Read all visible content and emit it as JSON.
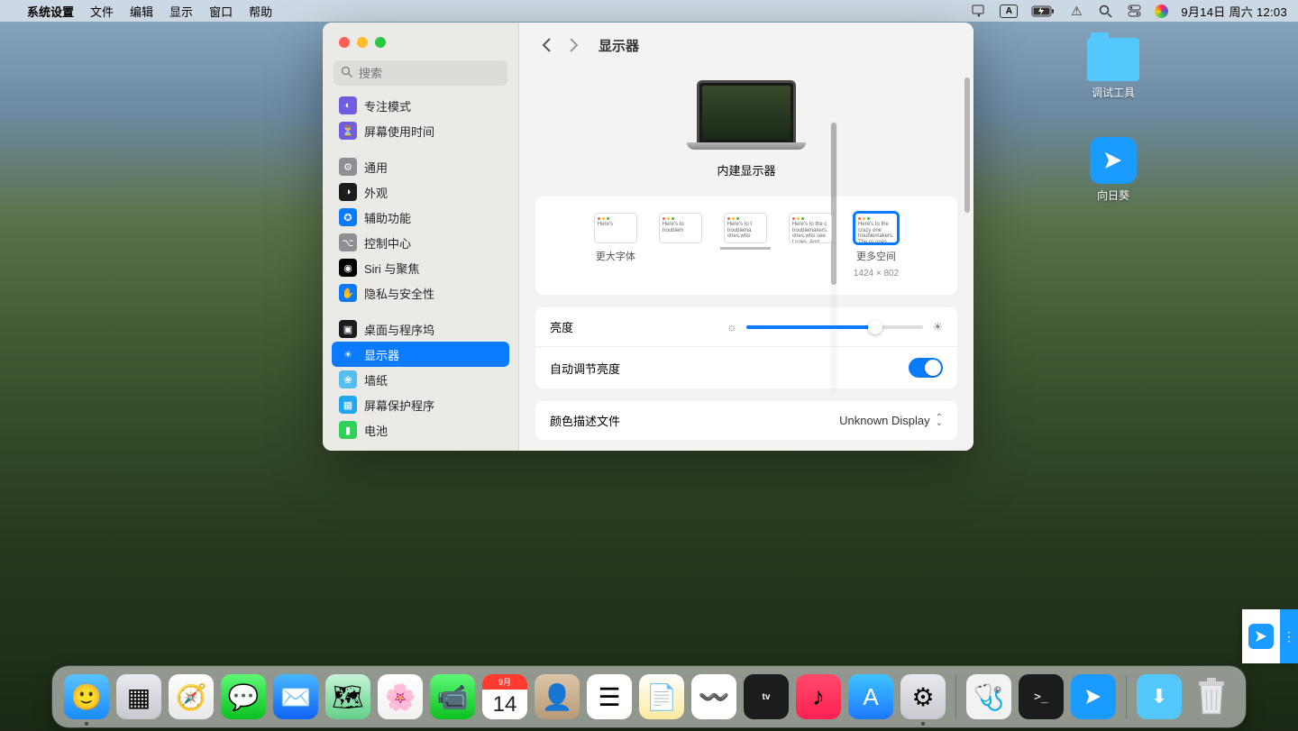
{
  "menubar": {
    "app": "系统设置",
    "items": [
      "文件",
      "编辑",
      "显示",
      "窗口",
      "帮助"
    ],
    "datetime": "9月14日 周六  12:03"
  },
  "desktop": {
    "icon1": "调试工具",
    "icon2": "向日葵"
  },
  "window": {
    "search_placeholder": "搜索",
    "title": "显示器",
    "sidebar": [
      {
        "label": "专注模式",
        "color": "#6f5ce0",
        "glyph": "◐"
      },
      {
        "label": "屏幕使用时间",
        "color": "#6f5ce0",
        "glyph": "⏳"
      },
      {
        "gap": true
      },
      {
        "label": "通用",
        "color": "#8e8e93",
        "glyph": "⚙"
      },
      {
        "label": "外观",
        "color": "#1c1c1e",
        "glyph": "◑"
      },
      {
        "label": "辅助功能",
        "color": "#0a7aff",
        "glyph": "✪"
      },
      {
        "label": "控制中心",
        "color": "#8e8e93",
        "glyph": "⌥"
      },
      {
        "label": "Siri 与聚焦",
        "color": "#000",
        "glyph": "◉"
      },
      {
        "label": "隐私与安全性",
        "color": "#0a7aff",
        "glyph": "✋"
      },
      {
        "gap": true
      },
      {
        "label": "桌面与程序坞",
        "color": "#1c1c1e",
        "glyph": "▣"
      },
      {
        "label": "显示器",
        "color": "#0a7aff",
        "glyph": "☀",
        "selected": true
      },
      {
        "label": "墙纸",
        "color": "#55bef0",
        "glyph": "❀"
      },
      {
        "label": "屏幕保护程序",
        "color": "#22a6ef",
        "glyph": "▦"
      },
      {
        "label": "电池",
        "color": "#30d158",
        "glyph": "▮"
      }
    ],
    "display_name": "内建显示器",
    "resolutions": {
      "larger": "更大字体",
      "more_space": "更多空间",
      "more_space_sub": "1424 × 802",
      "samples": [
        "Here's",
        "Here's to troublem",
        "Here's to t troublema ones who",
        "Here's to the c troublemakers. ones who see t rules. And they",
        "Here's to the crazy one troublemakers. The ro ones who see things d rules. And they have..."
      ]
    },
    "brightness_label": "亮度",
    "auto_brightness_label": "自动调节亮度",
    "color_profile_label": "颜色描述文件",
    "color_profile_value": "Unknown Display"
  },
  "dock": {
    "apps": [
      {
        "name": "finder",
        "bg": "linear-gradient(#59c3ff,#1a8bff)",
        "glyph": "🙂",
        "running": true
      },
      {
        "name": "launchpad",
        "bg": "linear-gradient(#e9e9ef,#c8c8d0)",
        "glyph": "▦"
      },
      {
        "name": "safari",
        "bg": "linear-gradient(#fefefe,#e8e8ea)",
        "glyph": "🧭"
      },
      {
        "name": "messages",
        "bg": "linear-gradient(#5ef777,#0bc11f)",
        "glyph": "💬"
      },
      {
        "name": "mail",
        "bg": "linear-gradient(#47b7ff,#1062f6)",
        "glyph": "✉️"
      },
      {
        "name": "maps",
        "bg": "linear-gradient(#c6f3d6,#64d08a)",
        "glyph": "🗺"
      },
      {
        "name": "photos",
        "bg": "linear-gradient(#fff,#f1f1f1)",
        "glyph": "🌸"
      },
      {
        "name": "facetime",
        "bg": "linear-gradient(#5ef777,#0bc11f)",
        "glyph": "📹"
      },
      {
        "name": "calendar",
        "bg": "#fff",
        "glyph": "",
        "cal": true
      },
      {
        "name": "contacts",
        "bg": "linear-gradient(#dcc6a8,#b89b78)",
        "glyph": "👤"
      },
      {
        "name": "reminders",
        "bg": "#fff",
        "glyph": "☰"
      },
      {
        "name": "notes",
        "bg": "linear-gradient(#fff,#ffe99e)",
        "glyph": "📄"
      },
      {
        "name": "freeform",
        "bg": "#fff",
        "glyph": "〰️"
      },
      {
        "name": "tv",
        "bg": "#1c1c1e",
        "glyph": "tv"
      },
      {
        "name": "music",
        "bg": "linear-gradient(#ff4a6b,#ff2151)",
        "glyph": "♪"
      },
      {
        "name": "appstore",
        "bg": "linear-gradient(#3fc4ff,#1c78ff)",
        "glyph": "A"
      },
      {
        "name": "settings",
        "bg": "linear-gradient(#e9e9ef,#c8c8d0)",
        "glyph": "⚙",
        "running": true
      }
    ],
    "right": [
      {
        "name": "diskutil",
        "bg": "#f2f2f2",
        "glyph": "🩺"
      },
      {
        "name": "terminal",
        "bg": "#1c1c1e",
        "glyph": ">_"
      },
      {
        "name": "sunlogin",
        "bg": "#1a9bff",
        "glyph": "◤"
      }
    ],
    "cal_month": "9月",
    "cal_day": "14"
  }
}
